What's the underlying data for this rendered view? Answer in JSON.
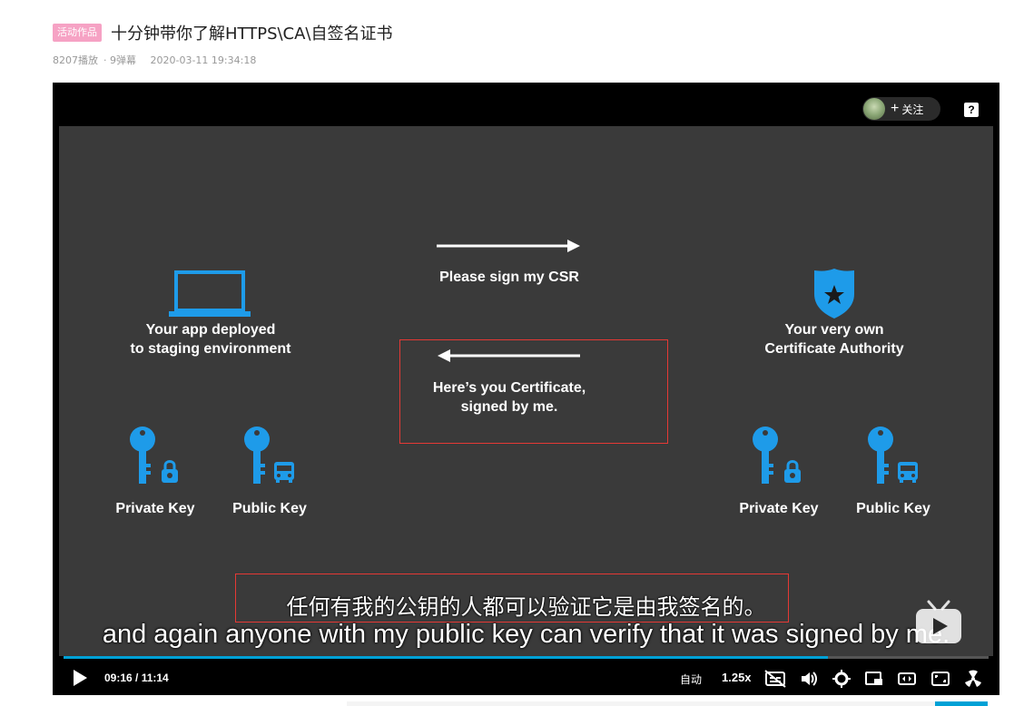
{
  "video": {
    "badge": "活动作品",
    "title": "十分钟带你了解HTTPS\\CA\\自签名证书",
    "plays": "8207播放",
    "danmaku": "· 9弹幕",
    "date": "2020-03-11 19:34:18"
  },
  "player_top": {
    "follow_plus": "+",
    "follow_label": "关注",
    "help": "?"
  },
  "slide": {
    "app_text": "Your app deployed\nto staging environment",
    "csr_text": "Please sign my CSR",
    "cert_text": "Here’s you Certificate,\nsigned by me.",
    "ca_text": "Your very own\nCertificate Authority",
    "left_private": "Private Key",
    "left_public": "Public Key",
    "right_private": "Private Key",
    "right_public": "Public Key"
  },
  "subtitles": {
    "chinese": "任何有我的公钥的人都可以验证它是由我签名的。",
    "english": "and again anyone with my public key can verify that it was signed by me."
  },
  "controls": {
    "time": "09:16 / 11:14",
    "progress": 0.826,
    "quality": "自动",
    "speed": "1.25x"
  },
  "colors": {
    "accent": "#00a1d6",
    "icon_blue": "#1e9be9",
    "badge_pink": "#f6a2c4",
    "highlight_red": "#e53935"
  }
}
